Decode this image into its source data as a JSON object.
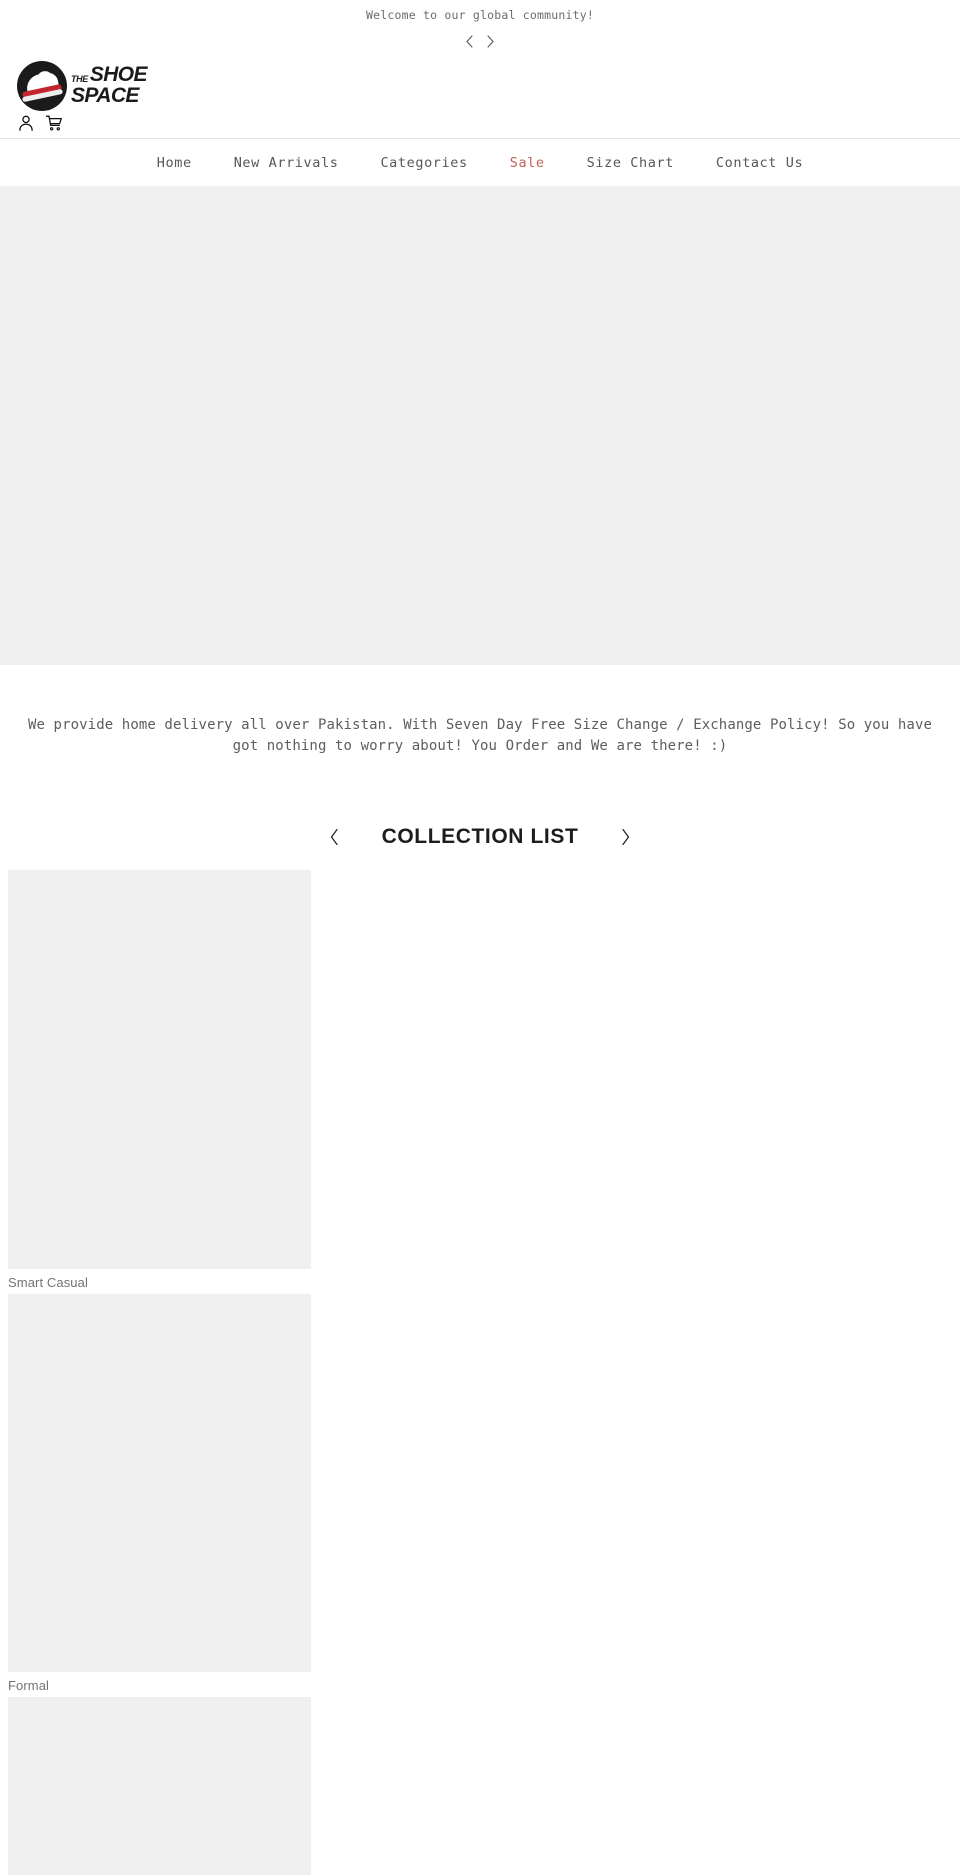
{
  "announcement": {
    "message": "Welcome to our global community!",
    "prev_label": "Previous announcement",
    "next_label": "Next announcement",
    "prev_icon": "chevron-left-icon",
    "next_icon": "chevron-right-icon"
  },
  "header": {
    "logo": {
      "the": "THE",
      "shoe": "SHOE",
      "space": "SPACE",
      "alt": "The Shoe Space"
    },
    "account_icon": "user-account-icon",
    "cart_icon": "shopping-cart-icon",
    "account_label": "Account",
    "cart_label": "Cart"
  },
  "nav": {
    "items": [
      {
        "label": "Home",
        "accent": false
      },
      {
        "label": "New Arrivals",
        "accent": false
      },
      {
        "label": "Categories",
        "accent": false
      },
      {
        "label": "Sale",
        "accent": true
      },
      {
        "label": "Size Chart",
        "accent": false
      },
      {
        "label": "Contact Us",
        "accent": false
      }
    ]
  },
  "hero": {
    "placeholder_label": "Hero banner image"
  },
  "promo": {
    "text": "We provide home delivery all over Pakistan. With Seven Day Free Size Change / Exchange Policy! So you have got nothing to worry about! You Order and We are there! :)"
  },
  "collections": {
    "title": "COLLECTION LIST",
    "prev_icon": "chevron-left-icon",
    "next_icon": "chevron-right-icon",
    "prev_label": "Previous collection",
    "next_label": "Next collection",
    "items": [
      {
        "name": "Smart Casual"
      },
      {
        "name": "Formal"
      },
      {
        "name": ""
      }
    ]
  },
  "colors": {
    "accent_sale": "#c4615a",
    "text_muted": "#6b6b6b",
    "text_body": "#5d5d5d",
    "placeholder_bg": "#efefef",
    "logo_red": "#c0262b",
    "logo_dark": "#1b1b1b",
    "border": "#e4e4e4"
  }
}
